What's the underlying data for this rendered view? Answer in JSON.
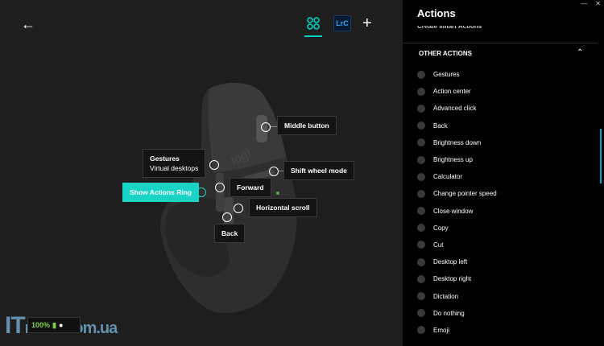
{
  "toolbar": {
    "back_icon": "arrow-left-icon",
    "apps_icon": "apps-grid-icon",
    "app_lrc": "LrC",
    "add_icon": "plus-icon"
  },
  "mouse_labels": {
    "middle_button": "Middle button",
    "gestures": "Gestures",
    "gestures_sub": "Virtual desktops",
    "shift_wheel": "Shift wheel mode",
    "actions_ring": "Show Actions Ring",
    "forward": "Forward",
    "horizontal_scroll": "Horizontal scroll",
    "back": "Back"
  },
  "status": {
    "battery": "100%"
  },
  "watermark": {
    "part1": "IT",
    "part2": "news.com.ua"
  },
  "actions_panel": {
    "title": "Actions",
    "clipped_item": "Create smart Actions",
    "section": "OTHER ACTIONS",
    "items": [
      "Gestures",
      "Action center",
      "Advanced click",
      "Back",
      "Brightness down",
      "Brightness up",
      "Calculator",
      "Change pointer speed",
      "Close window",
      "Copy",
      "Cut",
      "Desktop left",
      "Desktop right",
      "Dictation",
      "Do nothing",
      "Emoji"
    ]
  },
  "colors": {
    "accent": "#19d3c5",
    "panel_bg": "#000000",
    "canvas_bg": "#1e1e1e"
  }
}
